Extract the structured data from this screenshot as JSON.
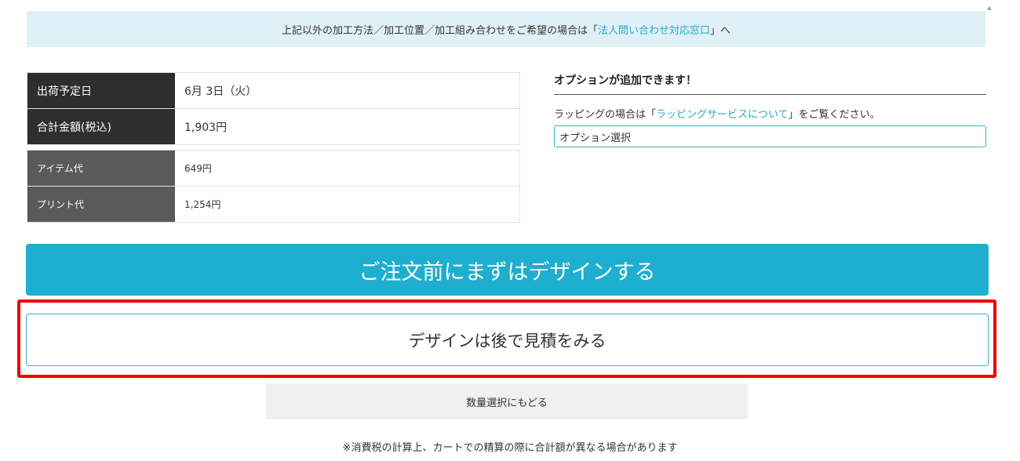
{
  "notice": {
    "prefix": "上記以外の加工方法／加工位置／加工組み合わせをご希望の場合は「",
    "link": "法人問い合わせ対応窓口",
    "suffix": "」へ"
  },
  "price_table": {
    "main_rows": [
      {
        "label": "出荷予定日",
        "value": "6月 3日（火）"
      },
      {
        "label": "合計金額(税込)",
        "value": "1,903円"
      }
    ],
    "detail_rows": [
      {
        "label": "アイテム代",
        "value": "649円"
      },
      {
        "label": "プリント代",
        "value": "1,254円"
      }
    ]
  },
  "options": {
    "title": "オプションが追加できます！",
    "note_prefix": "ラッピングの場合は「",
    "note_link": "ラッピングサービスについて",
    "note_suffix": "」をご覧ください。",
    "select_value": "オプション選択"
  },
  "buttons": {
    "design_first": "ご注文前にまずはデザインする",
    "estimate_later": "デザインは後で見積をみる",
    "back_to_quantity": "数量選択にもどる"
  },
  "footnote": "※消費税の計算上、カートでの精算の際に合計額が異なる場合があります",
  "colors": {
    "accent": "#1eaecf",
    "highlight": "#ee0000",
    "notice_bg": "#dff1f7",
    "link": "#2aa8c9"
  }
}
